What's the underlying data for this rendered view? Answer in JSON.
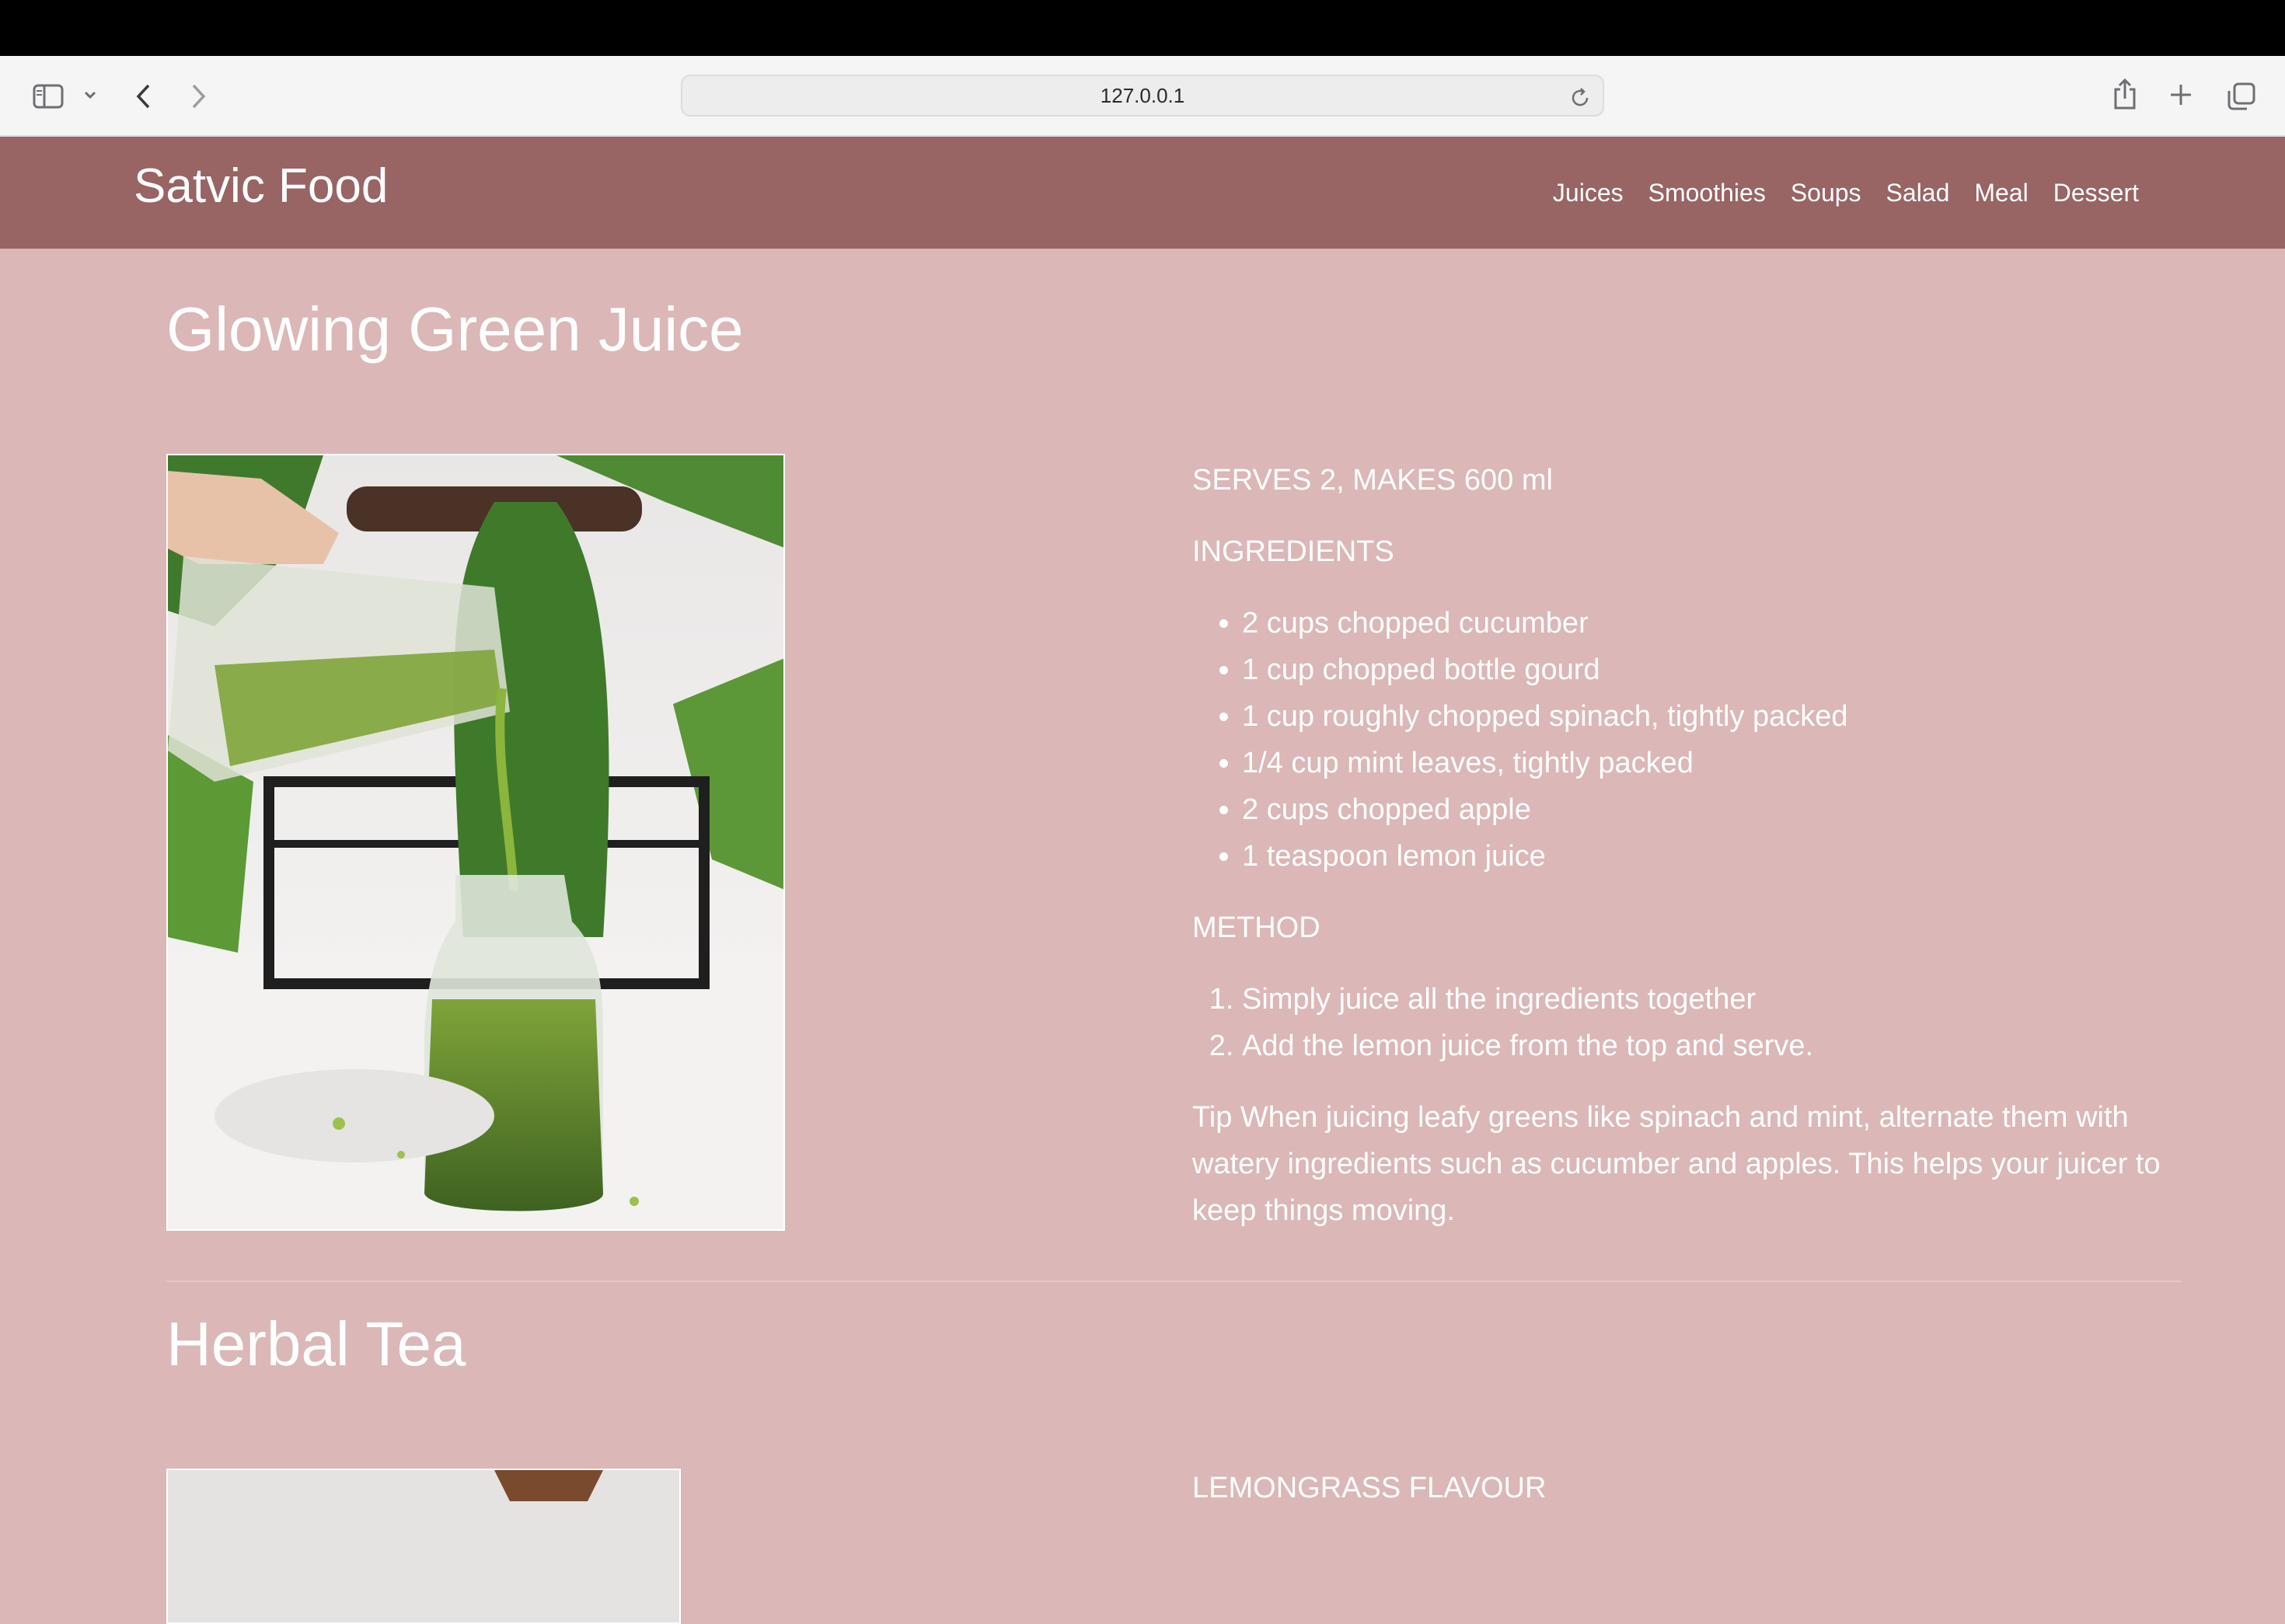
{
  "browser": {
    "url": "127.0.0.1",
    "icons": [
      "sidebar-icon",
      "chevron-down-icon",
      "back-icon",
      "forward-icon",
      "reload-icon",
      "share-icon",
      "plus-icon",
      "tabs-icon"
    ]
  },
  "site": {
    "brand": "Satvic Food",
    "nav": [
      "Juices",
      "Smoothies",
      "Soups",
      "Salad",
      "Meal",
      "Dessert"
    ]
  },
  "recipe1": {
    "title": "Glowing Green Juice",
    "serves": "SERVES 2, MAKES 600 ml",
    "ingredients_heading": "INGREDIENTS",
    "ingredients": [
      "2 cups chopped cucumber",
      "1 cup chopped bottle gourd",
      "1 cup roughly chopped spinach, tightly packed",
      "1/4 cup mint leaves, tightly packed",
      "2 cups chopped apple",
      "1 teaspoon lemon juice"
    ],
    "method_heading": "METHOD",
    "method": [
      "Simply juice all the ingredients together",
      "Add the lemon juice from the top and serve."
    ],
    "tip": "Tip When juicing leafy greens like spinach and mint, alternate them with watery ingredients such as cucumber and apples. This helps your juicer to keep things moving."
  },
  "recipe2": {
    "title": "Herbal Tea",
    "subtitle": "LEMONGRASS FLAVOUR"
  }
}
